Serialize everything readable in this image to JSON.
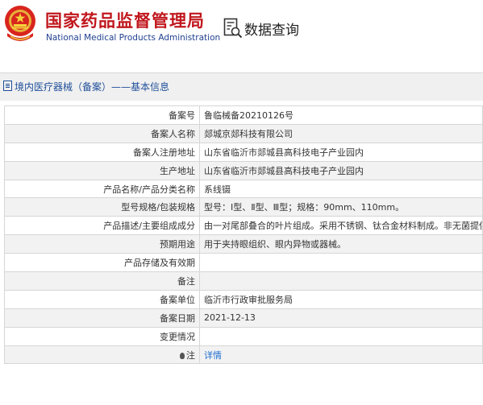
{
  "header": {
    "org_name_cn": "国家药品监督管理局",
    "org_name_en": "National Medical Products Administration",
    "query_title": "数据查询"
  },
  "breadcrumb": {
    "text": "境内医疗器械（备案）——基本信息"
  },
  "record": {
    "rows": [
      {
        "label": "备案号",
        "value": "鲁临械备20210126号"
      },
      {
        "label": "备案人名称",
        "value": "郯城京郯科技有限公司"
      },
      {
        "label": "备案人注册地址",
        "value": "山东省临沂市郯城县高科技电子产业园内"
      },
      {
        "label": "生产地址",
        "value": "山东省临沂市郯城县高科技电子产业园内"
      },
      {
        "label": "产品名称/产品分类名称",
        "value": "系线镊"
      },
      {
        "label": "型号规格/包装规格",
        "value": "型号：Ⅰ型、Ⅱ型、Ⅲ型；规格：90mm、110mm。"
      },
      {
        "label": "产品描述/主要组成成分",
        "value": "由一对尾部叠合的叶片组成。采用不锈钢、钛合金材料制成。非无菌提供。"
      },
      {
        "label": "预期用途",
        "value": "用于夹持眼组织、眼内异物或器械。"
      },
      {
        "label": "产品存储及有效期",
        "value": ""
      },
      {
        "label": "备注",
        "value": ""
      },
      {
        "label": "备案单位",
        "value": "临沂市行政审批服务局"
      },
      {
        "label": "备案日期",
        "value": "2021-12-13"
      },
      {
        "label": "变更情况",
        "value": ""
      }
    ],
    "note_label": "注",
    "note_link": "详情"
  }
}
